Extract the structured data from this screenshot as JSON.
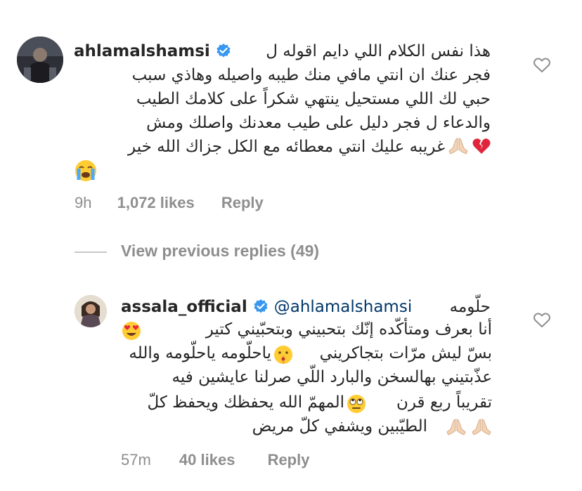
{
  "comment1": {
    "username": "ahlamalshamsi",
    "first_line": "هذا نفس الكلام اللي دايم اقوله ل",
    "lines": [
      "فجر عنك ان انتي مافي منك طيبه واصيله وهاذي سبب",
      "حبي لك اللي مستحيل ينتهي شكراً على كلامك الطيب",
      "والدعاء ل فجر دليل على طيب معدنك واصلك ومش",
      "غريبه عليك انتي معطائه مع الكل جزاك الله خير"
    ],
    "time": "9h",
    "likes": "1,072 likes",
    "reply": "Reply"
  },
  "replies": {
    "view_previous": "View previous replies (49)"
  },
  "comment2": {
    "username": "assala_official",
    "mention": "@ahlamalshamsi",
    "first_word": "حلّومه",
    "lines": [
      "أنا بعرف ومتأكّده إنّك بتحبيني وبتحبّيني كتير",
      "بسّ ليش مرّات بتجاكريني",
      "ياحلّومه ياحلّومه والله",
      "عذّبتيني بهالسخن والبارد اللّي صرلنا عايشين فيه",
      "تقريباً ربع قرن",
      "المهمّ الله يحفظك ويحفظ كلّ",
      "الطيّبين ويشفي كلّ مريض"
    ],
    "time": "57m",
    "likes": "40 likes",
    "reply": "Reply"
  },
  "colors": {
    "text": "#262626",
    "meta": "#8e8e8e",
    "verified": "#3897f0",
    "mention": "#00376b"
  },
  "icons": [
    "verified-badge-icon",
    "heart-outline-icon",
    "broken-heart-emoji",
    "praying-hands-emoji",
    "crying-face-emoji",
    "heart-eyes-emoji",
    "shushing-face-emoji",
    "eye-roll-emoji"
  ]
}
